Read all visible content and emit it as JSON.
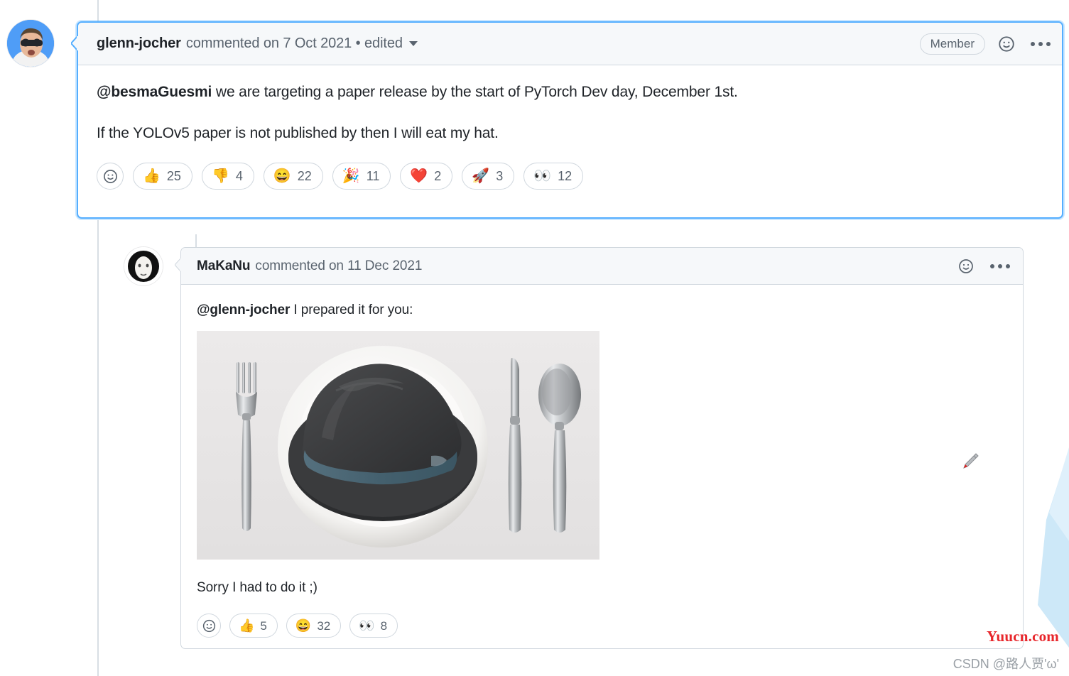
{
  "comments": [
    {
      "id": "comment-glenn-jocher",
      "author": "glenn-jocher",
      "meta": "commented on 7 Oct 2021 • edited",
      "badge": "Member",
      "highlighted": true,
      "paragraphs": [
        {
          "mention": "@besmaGuesmi",
          "rest": " we are targeting a paper release by the start of PyTorch Dev day, December 1st."
        },
        {
          "mention": "",
          "rest": "If the YOLOv5 paper is not published by then I will eat my hat."
        }
      ],
      "reactions": [
        {
          "name": "thumbs-up",
          "emoji": "👍",
          "count": "25"
        },
        {
          "name": "thumbs-down",
          "emoji": "👎",
          "count": "4"
        },
        {
          "name": "laugh",
          "emoji": "😄",
          "count": "22"
        },
        {
          "name": "hooray",
          "emoji": "🎉",
          "count": "11"
        },
        {
          "name": "heart",
          "emoji": "❤️",
          "count": "2"
        },
        {
          "name": "rocket",
          "emoji": "🚀",
          "count": "3"
        },
        {
          "name": "eyes",
          "emoji": "👀",
          "count": "12"
        }
      ]
    },
    {
      "id": "comment-makanu",
      "author": "MaKaNu",
      "meta": "commented on 11 Dec 2021",
      "badge": "",
      "highlighted": false,
      "paragraphs": [
        {
          "mention": "@glenn-jocher",
          "rest": " I prepared it for you:"
        },
        {
          "mention": "",
          "rest": "Sorry I had to do it ;)"
        }
      ],
      "image_alt": "dark gray fedora hat served on a white plate with fork, knife and spoon",
      "reactions": [
        {
          "name": "thumbs-up",
          "emoji": "👍",
          "count": "5"
        },
        {
          "name": "laugh",
          "emoji": "😄",
          "count": "32"
        },
        {
          "name": "eyes",
          "emoji": "👀",
          "count": "8"
        }
      ]
    }
  ],
  "icons": {
    "add_reaction": "smiley-icon",
    "overflow_menu": "kebab-menu-icon",
    "caret": "chevron-down-icon",
    "cursor": "pen-cursor-icon"
  },
  "watermarks": {
    "primary": "Yuucn.com",
    "secondary": "CSDN @路人贾'ω'"
  },
  "colors": {
    "highlight_border": "#54aeff",
    "card_border": "#d0d7de",
    "header_bg": "#f6f8fa",
    "text": "#1f2328",
    "muted_text": "#59636e",
    "watermark_red": "#e8262b",
    "edge_shape_blue": "#cde8f8"
  }
}
